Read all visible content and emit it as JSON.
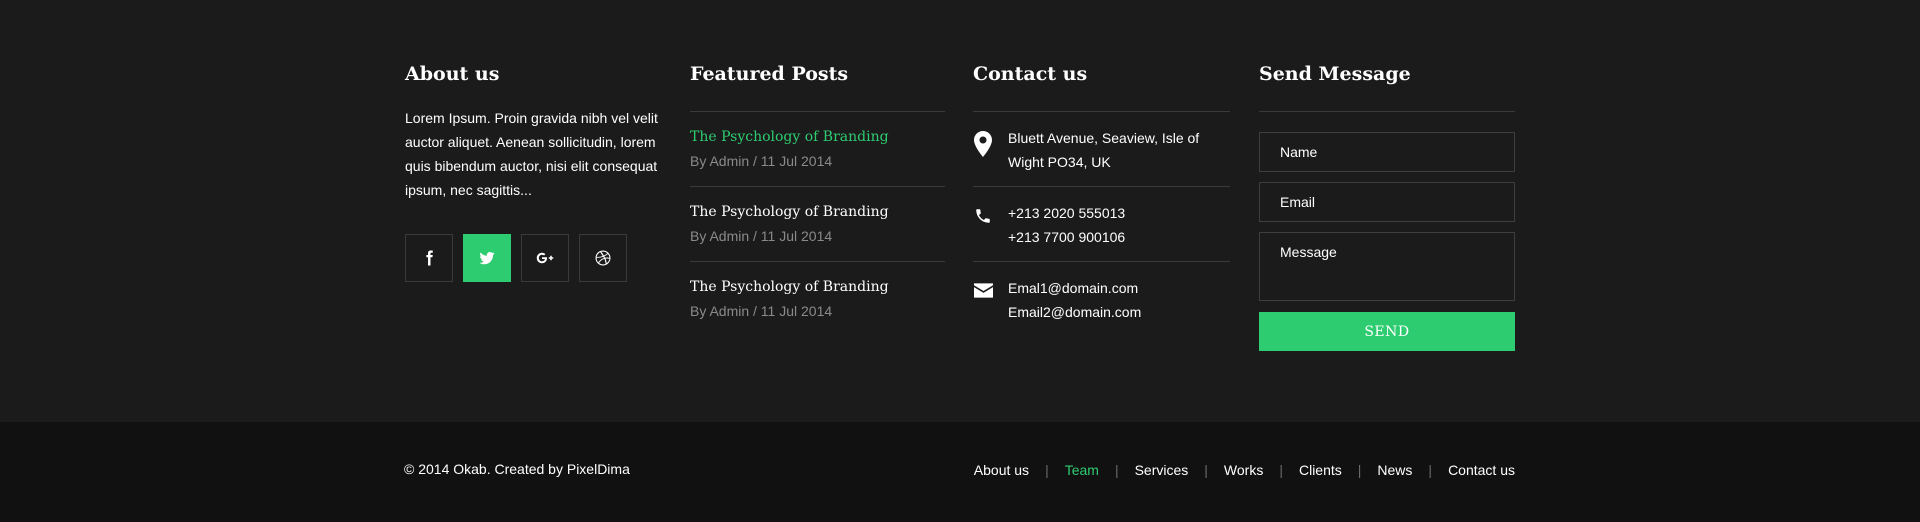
{
  "about": {
    "heading": "About us",
    "text": "Lorem Ipsum. Proin gravida nibh vel velit auctor aliquet. Aenean sollicitudin, lorem quis bibendum auctor, nisi elit consequat ipsum, nec sagittis...",
    "socials": [
      {
        "icon": "facebook-icon",
        "active": false
      },
      {
        "icon": "twitter-icon",
        "active": true
      },
      {
        "icon": "google-plus-icon",
        "active": false
      },
      {
        "icon": "dribbble-icon",
        "active": false
      }
    ]
  },
  "posts": {
    "heading": "Featured Posts",
    "items": [
      {
        "title": "The Psychology of Branding",
        "meta": "By Admin / 11 Jul 2014"
      },
      {
        "title": "The Psychology of Branding",
        "meta": "By Admin / 11 Jul 2014"
      },
      {
        "title": "The Psychology of Branding",
        "meta": "By Admin / 11 Jul 2014"
      }
    ]
  },
  "contact": {
    "heading": "Contact us",
    "address_line1": "Bluett Avenue, Seaview, Isle of",
    "address_line2": "Wight PO34, UK",
    "phone1": "+213 2020 555013",
    "phone2": "+213 7700 900106",
    "email1": "Emal1@domain.com",
    "email2": "Email2@domain.com"
  },
  "send": {
    "heading": "Send Message",
    "name_placeholder": "Name",
    "email_placeholder": "Email",
    "message_placeholder": "Message",
    "button": "SEND"
  },
  "footer": {
    "copyright": "© 2014  Okab.  Created by PixelDima",
    "nav": [
      "About us",
      "Team",
      "Services",
      "Works",
      "Clients",
      "News",
      "Contact us"
    ],
    "active_nav": "Team"
  },
  "colors": {
    "accent": "#2ecc71",
    "background": "#1b1b1b",
    "bottom_bar": "#111111"
  }
}
